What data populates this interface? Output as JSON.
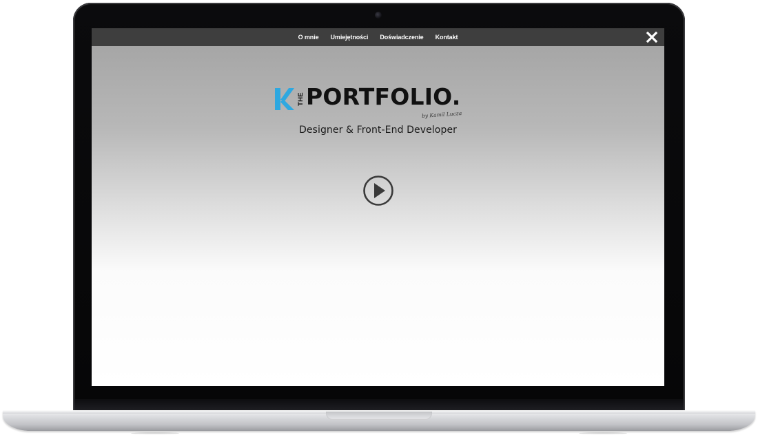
{
  "nav": {
    "items": [
      {
        "label": "O mnie"
      },
      {
        "label": "Umiejętności"
      },
      {
        "label": "Doświadczenie"
      },
      {
        "label": "Kontakt"
      }
    ],
    "close_icon": "close-icon"
  },
  "hero": {
    "logo_mark": "K",
    "logo_the": "THE",
    "logo_title": "PORTFOLIO.",
    "signature": "by Kamil Lucza",
    "subtitle": "Designer & Front-End Developer",
    "play_icon": "play-circle-icon"
  },
  "colors": {
    "accent": "#2ea8e0",
    "navbar": "#3e3e3e",
    "text": "#111111"
  }
}
